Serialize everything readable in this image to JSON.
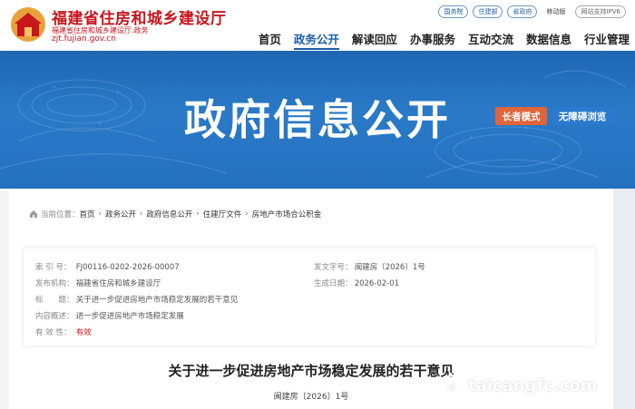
{
  "header": {
    "site_title": "福建省住房和城乡建设厅",
    "site_sub": "福建省住房和城乡建设厅.政务",
    "site_url": "zjt.fujian.gov.cn",
    "top_links": [
      "国务院",
      "住建部",
      "省政府"
    ],
    "mobile_label": "移动版",
    "ipv6_label": "网站支持IPV6"
  },
  "nav": {
    "items": [
      "首页",
      "政务公开",
      "解读回应",
      "办事服务",
      "互动交流",
      "数据信息",
      "行业管理"
    ],
    "active_index": 1
  },
  "banner": {
    "title": "政府信息公开",
    "elder_mode": "长者模式",
    "accessible": "无障碍浏览"
  },
  "breadcrumb": {
    "label": "当前位置：",
    "items": [
      "首页",
      "政务公开",
      "政府信息公开",
      "住建厅文件",
      "房地产市场合公积金"
    ]
  },
  "meta": {
    "index_label": "索 引 号：",
    "index_value": "FJ00116-0202-2026-00007",
    "doc_no_label": "发文字号：",
    "doc_no_value": "闽建房〔2026〕1号",
    "org_label": "发布机构：",
    "org_value": "福建省住房和城乡建设厅",
    "date_label": "生成日期：",
    "date_value": "2026-02-01",
    "title_label": "标　　题：",
    "title_value": "关于进一步促进房地产市场稳定发展的若干意见",
    "summary_label": "内容概述：",
    "summary_value": "进一步促进房地产市场稳定发展",
    "validity_label": "有 效 性：",
    "validity_value": "有效"
  },
  "document": {
    "title": "关于进一步促进房地产市场稳定发展的若干意见",
    "doc_no": "闽建房〔2026〕1号"
  },
  "watermark": {
    "text": "taicangfc.com"
  },
  "colors": {
    "brand_red": "#c8161d",
    "nav_blue": "#1b5faa",
    "banner_blue": "#2470bf",
    "elder_orange": "#e2643a"
  }
}
